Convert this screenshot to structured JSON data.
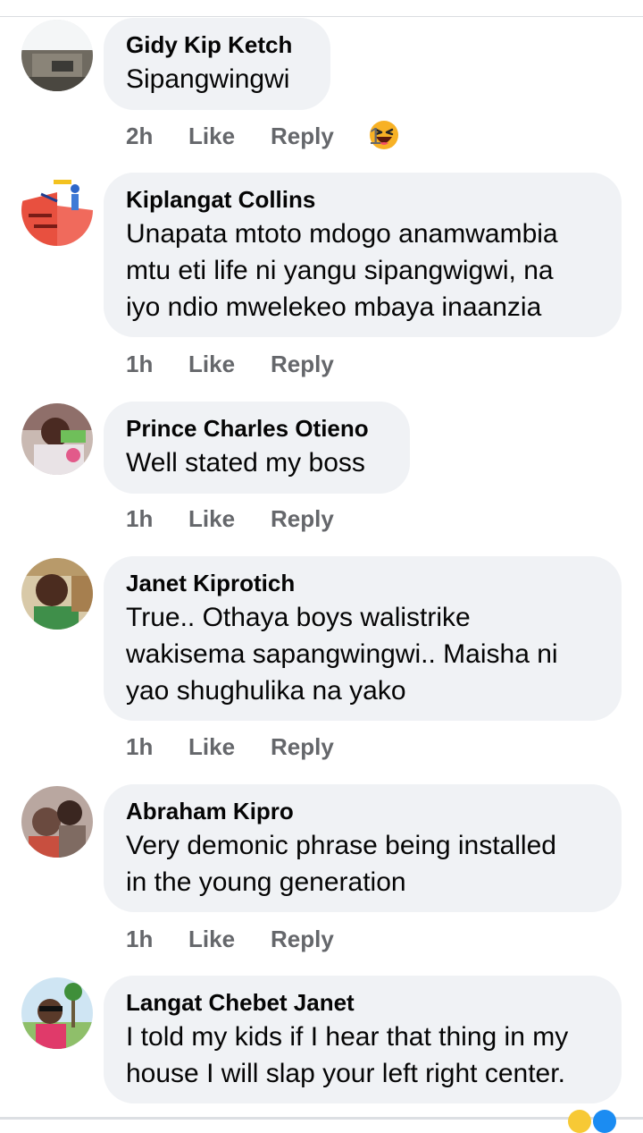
{
  "comments": [
    {
      "author": "Gidy Kip Ketch",
      "text": "Sipangwingwi",
      "time": "2h",
      "like_label": "Like",
      "reply_label": "Reply",
      "reaction_count": "1",
      "reaction_icon": "laughing-emoji-icon"
    },
    {
      "author": "Kiplangat Collins",
      "text": "Unapata mtoto mdogo anamwambia\nmtu eti life ni yangu sipangwigwi, na\niyo ndio mwelekeo mbaya inaanzia",
      "time": "1h",
      "like_label": "Like",
      "reply_label": "Reply"
    },
    {
      "author": "Prince Charles Otieno",
      "text": "Well stated my boss",
      "time": "1h",
      "like_label": "Like",
      "reply_label": "Reply"
    },
    {
      "author": "Janet Kiprotich",
      "text": "True.. Othaya boys walistrike\nwakisema sapangwingwi.. Maisha ni\nyao shughulika na yako",
      "time": "1h",
      "like_label": "Like",
      "reply_label": "Reply"
    },
    {
      "author": "Abraham Kipro",
      "text": "Very demonic phrase being installed\nin the young generation",
      "time": "1h",
      "like_label": "Like",
      "reply_label": "Reply"
    },
    {
      "author": "Langat Chebet Janet",
      "text": "I told my kids if I hear that thing in my\nhouse I will slap your left right center.",
      "time": "",
      "like_label": "",
      "reply_label": ""
    }
  ],
  "colors": {
    "bubble": "#f0f2f5",
    "meta": "#65676b",
    "text": "#050505"
  }
}
